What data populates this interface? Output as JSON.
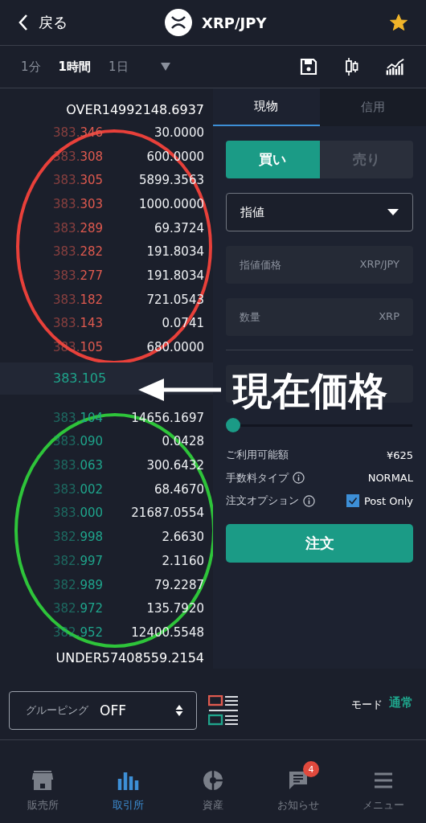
{
  "header": {
    "back": "戻る",
    "title": "XRP/JPY",
    "favorite": true
  },
  "timeframes": [
    {
      "label": "1分",
      "selected": false
    },
    {
      "label": "1時間",
      "selected": true
    },
    {
      "label": "1日",
      "selected": false
    }
  ],
  "orderbook": {
    "over": "OVER14992148.6937",
    "asks": [
      {
        "price": "383.346",
        "qty": "30.0000"
      },
      {
        "price": "383.308",
        "qty": "600.0000"
      },
      {
        "price": "383.305",
        "qty": "5899.3563"
      },
      {
        "price": "383.303",
        "qty": "1000.0000"
      },
      {
        "price": "383.289",
        "qty": "69.3724"
      },
      {
        "price": "383.282",
        "qty": "191.8034"
      },
      {
        "price": "383.277",
        "qty": "191.8034"
      },
      {
        "price": "383.182",
        "qty": "721.0543"
      },
      {
        "price": "383.143",
        "qty": "0.0741"
      },
      {
        "price": "383.105",
        "qty": "680.0000"
      }
    ],
    "current": "383.105",
    "bids": [
      {
        "price": "383.104",
        "qty": "14656.1697"
      },
      {
        "price": "383.090",
        "qty": "0.0428"
      },
      {
        "price": "383.063",
        "qty": "300.6432"
      },
      {
        "price": "383.002",
        "qty": "68.4670"
      },
      {
        "price": "383.000",
        "qty": "21687.0554"
      },
      {
        "price": "382.998",
        "qty": "2.6630"
      },
      {
        "price": "382.997",
        "qty": "2.1160"
      },
      {
        "price": "382.989",
        "qty": "79.2287"
      },
      {
        "price": "382.972",
        "qty": "135.7920"
      },
      {
        "price": "382.952",
        "qty": "12400.5548"
      }
    ],
    "under": "UNDER57408559.2154"
  },
  "trade_tabs": [
    {
      "label": "現物",
      "selected": true
    },
    {
      "label": "信用",
      "selected": false
    }
  ],
  "sides": [
    {
      "label": "買い",
      "selected": true
    },
    {
      "label": "売り",
      "selected": false
    }
  ],
  "order_type": "指値",
  "fields": [
    {
      "placeholder": "指値価格",
      "unit": "XRP/JPY"
    },
    {
      "placeholder": "数量",
      "unit": "XRP"
    }
  ],
  "slider": {
    "level": 0
  },
  "info": [
    {
      "label": "ご利用可能額",
      "value": "¥625",
      "kind": "text",
      "info_icon": false
    },
    {
      "label": "手数料タイプ",
      "value": "NORMAL",
      "kind": "text",
      "info_icon": true
    },
    {
      "label": "注文オプション",
      "value": "Post Only",
      "kind": "checkbox",
      "checked": true,
      "info_icon": true
    }
  ],
  "order_button": "注文",
  "grouping": {
    "label": "グルーピング",
    "value": "OFF"
  },
  "mode": {
    "label": "モード",
    "value": "通常"
  },
  "nav": [
    {
      "label": "販売所",
      "selected": false
    },
    {
      "label": "取引所",
      "selected": true
    },
    {
      "label": "資産",
      "selected": false
    },
    {
      "label": "お知らせ",
      "selected": false,
      "badge": "4"
    },
    {
      "label": "メニュー",
      "selected": false
    }
  ],
  "annotation": {
    "label": "現在価格"
  }
}
